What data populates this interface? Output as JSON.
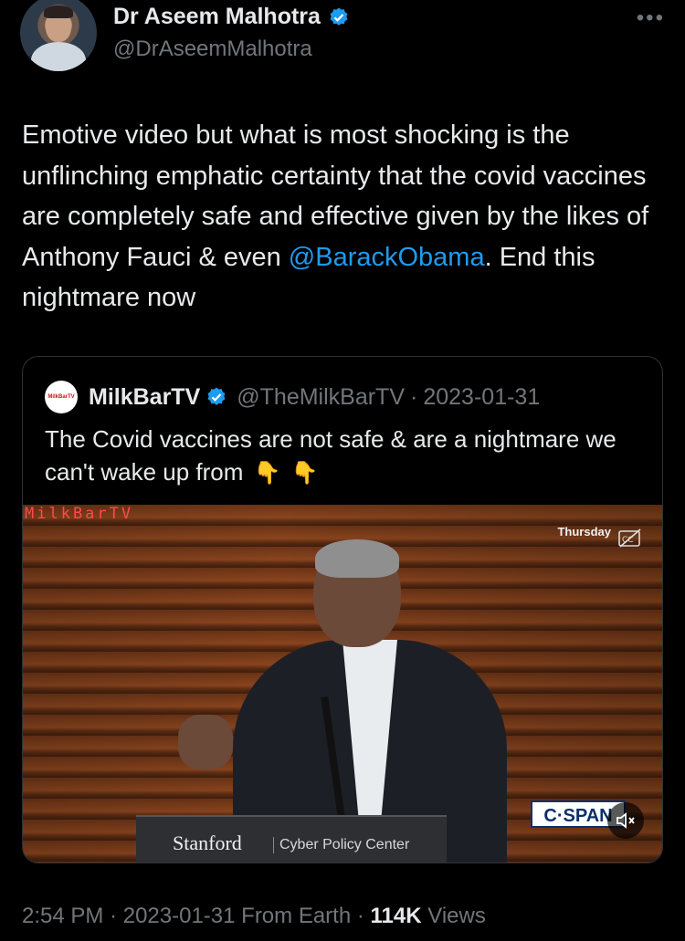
{
  "author": {
    "name": "Dr Aseem Malhotra",
    "handle": "@DrAseemMalhotra"
  },
  "more_label": "•••",
  "tweet": {
    "text_before": "Emotive video but what is most shocking is the unflinching emphatic certainty that the covid vaccines are completely safe and effective given by the likes of Anthony Fauci & even ",
    "mention": "@BarackObama",
    "text_after": ". End this nightmare now"
  },
  "quoted": {
    "avatar_text": "MilkBarTV",
    "name": "MilkBarTV",
    "handle": "@TheMilkBarTV",
    "separator": "·",
    "date": "2023-01-31",
    "text": "The Covid vaccines are not safe & are a nightmare we can't wake up from",
    "emoji": "👇",
    "emoji2": "👇",
    "video": {
      "watermark": "MilkBarTV",
      "overlay_day": "Thursday",
      "podium_label": "Stanford",
      "podium_sub": "Cyber Policy Center",
      "network_logo": "C·SPAN"
    }
  },
  "footer": {
    "time": "2:54 PM",
    "sep1": " · ",
    "date": "2023-01-31",
    "source": " From Earth",
    "sep2": " · ",
    "views_count": "114K",
    "views_label": " Views"
  },
  "colors": {
    "background": "#000000",
    "text": "#e7e9ea",
    "muted": "#71767b",
    "link": "#1d9bf0",
    "verified": "#1d9bf0"
  }
}
